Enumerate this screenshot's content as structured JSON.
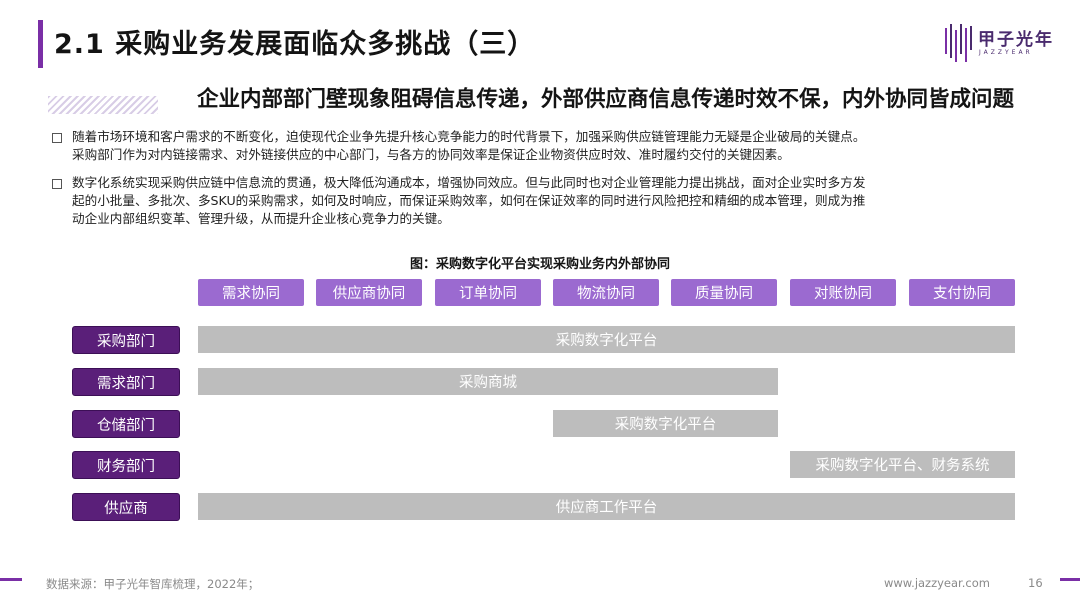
{
  "header": {
    "title": "2.1 采购业务发展面临众多挑战（三）",
    "logo_cn": "甲子光年",
    "logo_en": "JAZZYEAR"
  },
  "subtitle": "企业内部部门壁现象阻碍信息传递，外部供应商信息传递时效不保，内外协同皆成问题",
  "paragraphs": [
    {
      "lines": [
        "随着市场环境和客户需求的不断变化，迫使现代企业争先提升核心竞争能力的时代背景下，加强采购供应链管理能力无疑是企业破局的关键点。",
        "采购部门作为对内链接需求、对外链接供应的中心部门，与各方的协同效率是保证企业物资供应时效、准时履约交付的关键因素。"
      ]
    },
    {
      "lines": [
        "数字化系统实现采购供应链中信息流的贯通，极大降低沟通成本，增强协同效应。但与此同时也对企业管理能力提出挑战，面对企业实时多方发",
        "起的小批量、多批次、多SKU的采购需求，如何及时响应，而保证采购效率，如何在保证效率的同时进行风险把控和精细的成本管理，则成为推",
        "动企业内部组织变革、管理升级，从而提升企业核心竞争力的关键。"
      ]
    }
  ],
  "figure": {
    "title": "图：采购数字化平台实现采购业务内外部协同",
    "collaborations": [
      "需求协同",
      "供应商协同",
      "订单协同",
      "物流协同",
      "质量协同",
      "对账协同",
      "支付协同"
    ],
    "departments": [
      "采购部门",
      "需求部门",
      "仓储部门",
      "财务部门",
      "供应商"
    ],
    "bars": [
      "采购数字化平台",
      "采购商城",
      "采购数字化平台",
      "采购数字化平台、财务系统",
      "供应商工作平台"
    ]
  },
  "footer": {
    "source": "数据来源：甲子光年智库梳理，2022年；",
    "url": "www.jazzyear.com",
    "page": "16"
  },
  "colors": {
    "accent": "#7a2fa6",
    "collab_fill": "#9b6ad0",
    "dept_fill": "#5a1f79",
    "bar_fill": "#bdbdbd"
  }
}
